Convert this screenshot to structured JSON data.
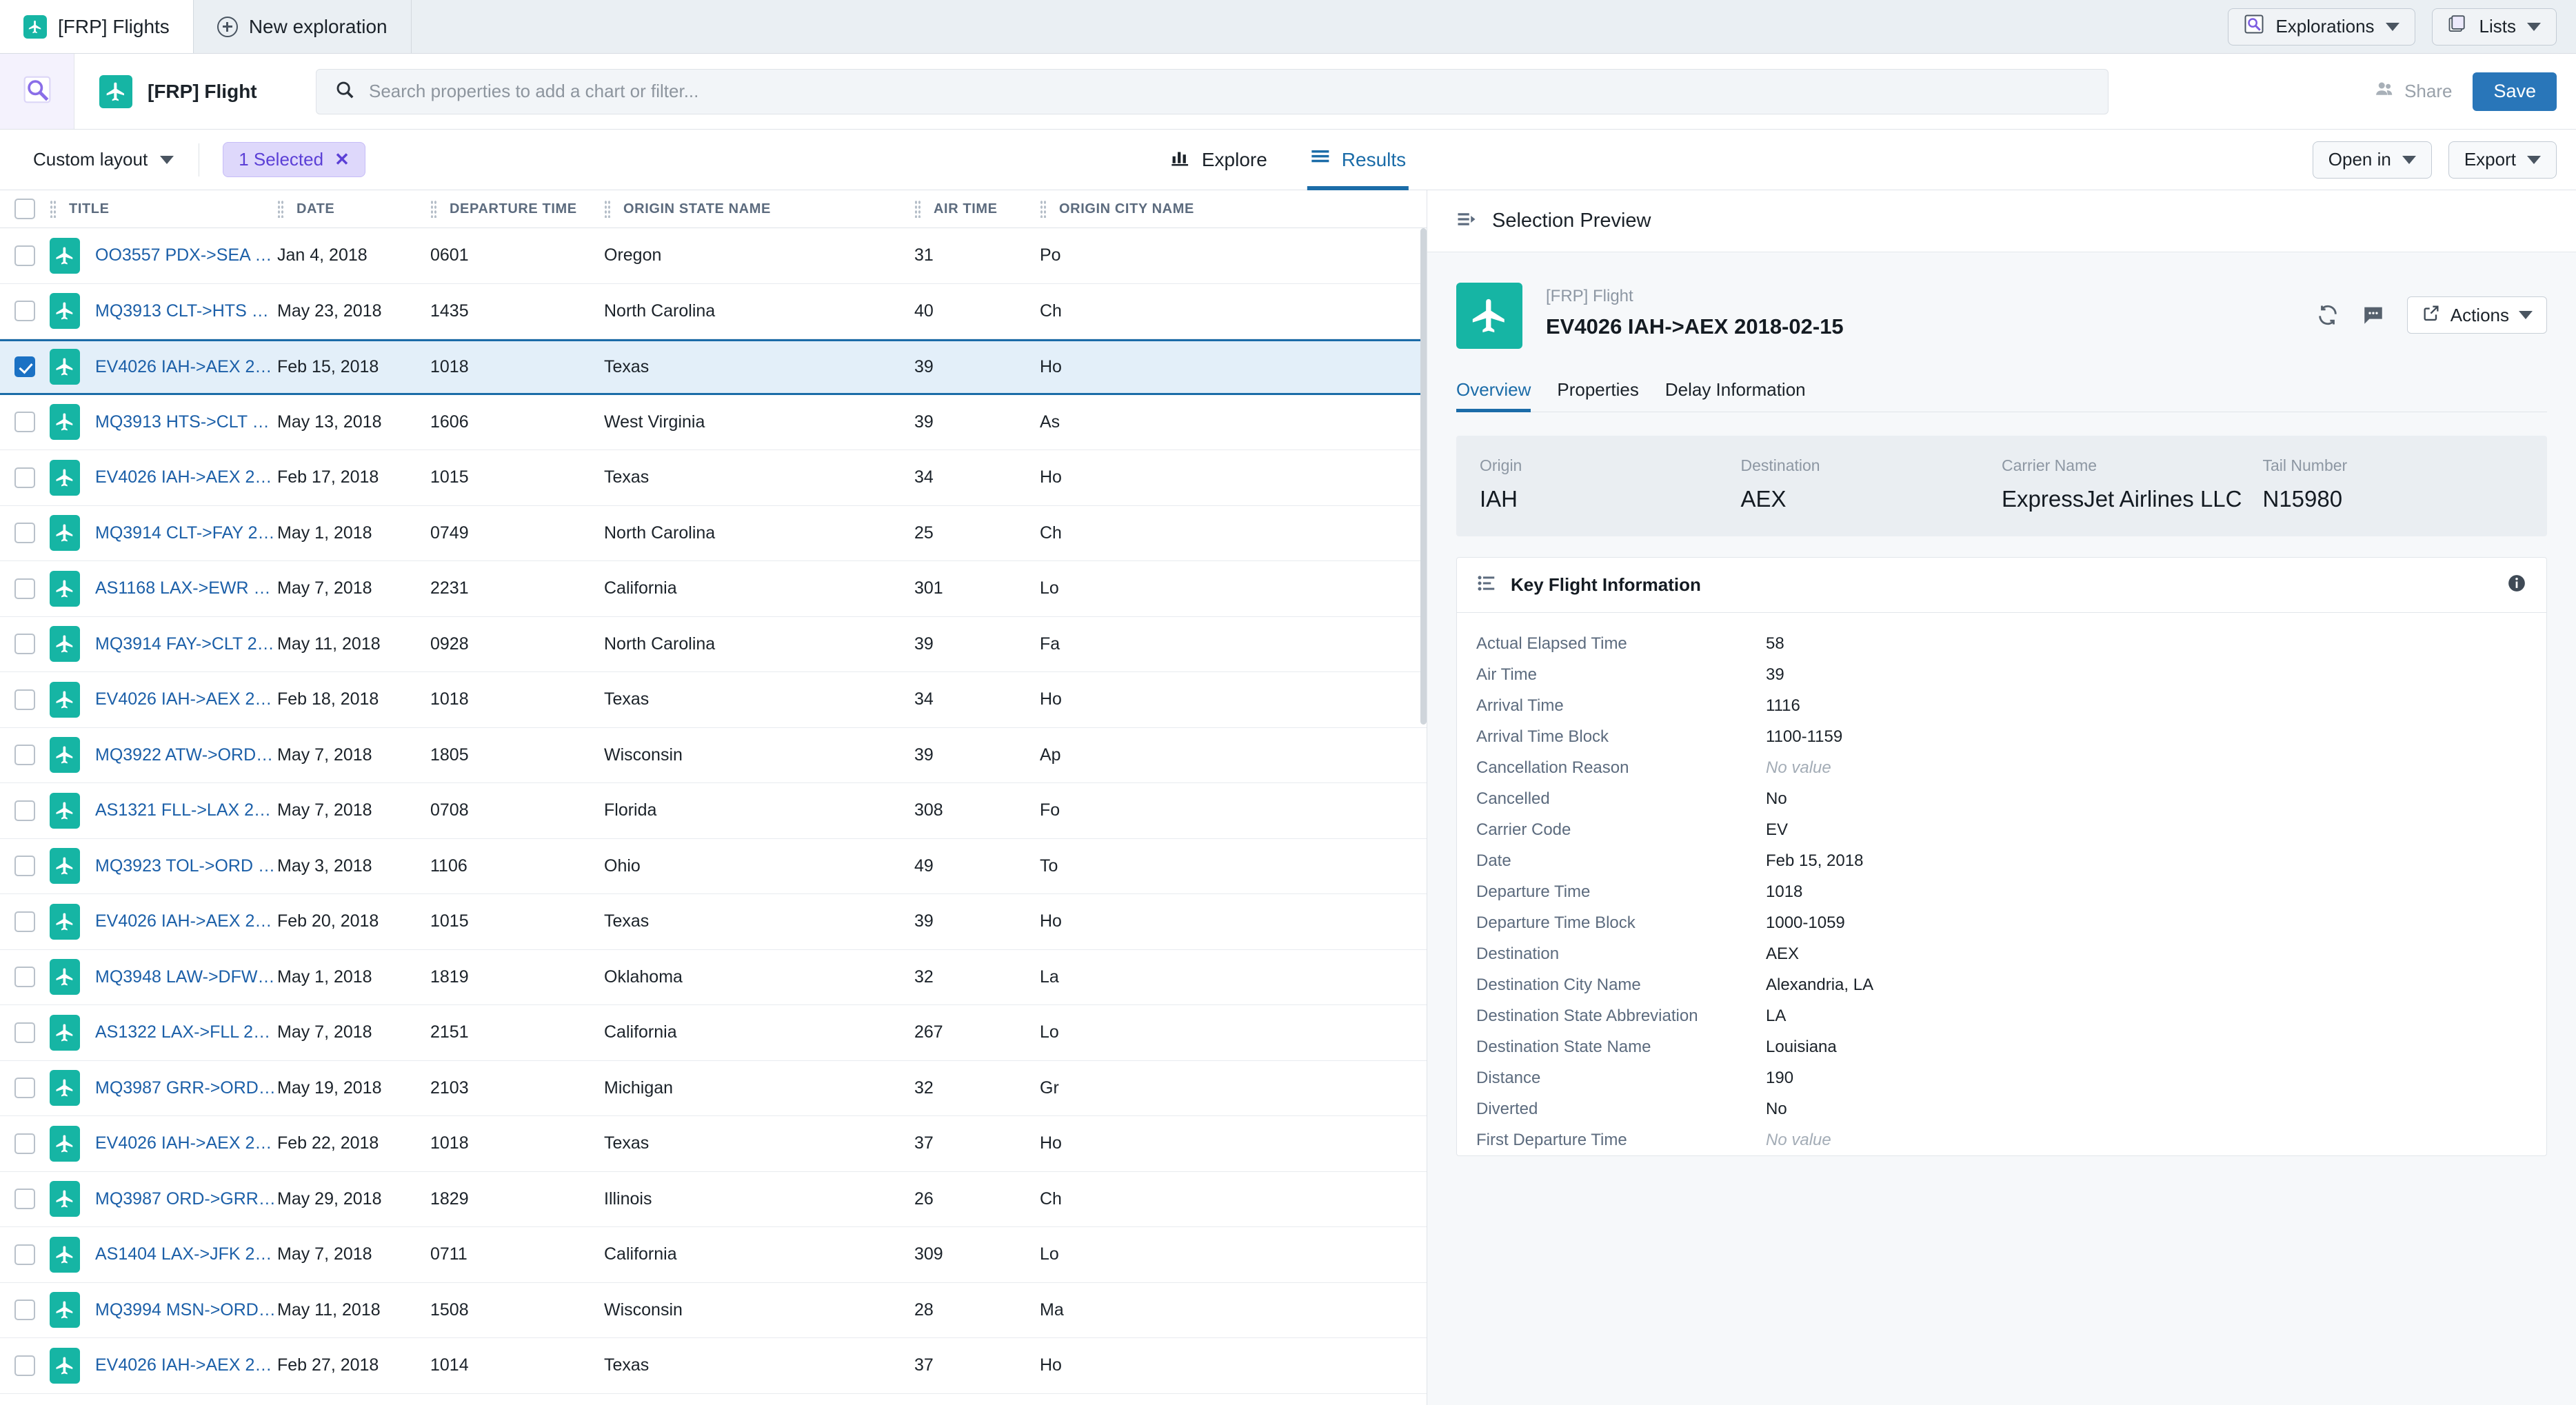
{
  "tabbar": {
    "tabs": [
      {
        "label": "[FRP] Flights",
        "icon": "plane-icon",
        "active": true
      },
      {
        "label": "New exploration",
        "icon": "plus-circle-icon",
        "active": false
      }
    ],
    "explorations_label": "Explorations",
    "lists_label": "Lists"
  },
  "searchrow": {
    "object_title": "[FRP] Flight",
    "search_placeholder": "Search properties to add a chart or filter...",
    "share_label": "Share",
    "save_label": "Save"
  },
  "toolbar": {
    "layout_label": "Custom layout",
    "selection_chip": "1 Selected",
    "selection_chip_close": "✕",
    "tabs": [
      {
        "label": "Explore",
        "icon": "bar-chart-icon",
        "active": false
      },
      {
        "label": "Results",
        "icon": "list-icon",
        "active": true
      }
    ],
    "open_in_label": "Open in",
    "export_label": "Export"
  },
  "table": {
    "columns": [
      "TITLE",
      "DATE",
      "DEPARTURE TIME",
      "ORIGIN STATE NAME",
      "AIR TIME",
      "ORIGIN CITY NAME"
    ],
    "rows": [
      {
        "selected": false,
        "title": "OO3557 PDX->SEA 2018...",
        "date": "Jan 4, 2018",
        "departure_time": "0601",
        "origin_state": "Oregon",
        "air_time": "31",
        "origin_city": "Po"
      },
      {
        "selected": false,
        "title": "MQ3913 CLT->HTS 2018...",
        "date": "May 23, 2018",
        "departure_time": "1435",
        "origin_state": "North Carolina",
        "air_time": "40",
        "origin_city": "Ch"
      },
      {
        "selected": true,
        "title": "EV4026 IAH->AEX 2018-...",
        "date": "Feb 15, 2018",
        "departure_time": "1018",
        "origin_state": "Texas",
        "air_time": "39",
        "origin_city": "Ho"
      },
      {
        "selected": false,
        "title": "MQ3913 HTS->CLT 2018...",
        "date": "May 13, 2018",
        "departure_time": "1606",
        "origin_state": "West Virginia",
        "air_time": "39",
        "origin_city": "As"
      },
      {
        "selected": false,
        "title": "EV4026 IAH->AEX 2018-...",
        "date": "Feb 17, 2018",
        "departure_time": "1015",
        "origin_state": "Texas",
        "air_time": "34",
        "origin_city": "Ho"
      },
      {
        "selected": false,
        "title": "MQ3914 CLT->FAY 2018...",
        "date": "May 1, 2018",
        "departure_time": "0749",
        "origin_state": "North Carolina",
        "air_time": "25",
        "origin_city": "Ch"
      },
      {
        "selected": false,
        "title": "AS1168 LAX->EWR 201...",
        "date": "May 7, 2018",
        "departure_time": "2231",
        "origin_state": "California",
        "air_time": "301",
        "origin_city": "Lo"
      },
      {
        "selected": false,
        "title": "MQ3914 FAY->CLT 2018...",
        "date": "May 11, 2018",
        "departure_time": "0928",
        "origin_state": "North Carolina",
        "air_time": "39",
        "origin_city": "Fa"
      },
      {
        "selected": false,
        "title": "EV4026 IAH->AEX 2018-...",
        "date": "Feb 18, 2018",
        "departure_time": "1018",
        "origin_state": "Texas",
        "air_time": "34",
        "origin_city": "Ho"
      },
      {
        "selected": false,
        "title": "MQ3922 ATW->ORD 201...",
        "date": "May 7, 2018",
        "departure_time": "1805",
        "origin_state": "Wisconsin",
        "air_time": "39",
        "origin_city": "Ap"
      },
      {
        "selected": false,
        "title": "AS1321 FLL->LAX 2018...",
        "date": "May 7, 2018",
        "departure_time": "0708",
        "origin_state": "Florida",
        "air_time": "308",
        "origin_city": "Fo"
      },
      {
        "selected": false,
        "title": "MQ3923 TOL->ORD 201...",
        "date": "May 3, 2018",
        "departure_time": "1106",
        "origin_state": "Ohio",
        "air_time": "49",
        "origin_city": "To"
      },
      {
        "selected": false,
        "title": "EV4026 IAH->AEX 2018-...",
        "date": "Feb 20, 2018",
        "departure_time": "1015",
        "origin_state": "Texas",
        "air_time": "39",
        "origin_city": "Ho"
      },
      {
        "selected": false,
        "title": "MQ3948 LAW->DFW 201...",
        "date": "May 1, 2018",
        "departure_time": "1819",
        "origin_state": "Oklahoma",
        "air_time": "32",
        "origin_city": "La"
      },
      {
        "selected": false,
        "title": "AS1322 LAX->FLL 2018...",
        "date": "May 7, 2018",
        "departure_time": "2151",
        "origin_state": "California",
        "air_time": "267",
        "origin_city": "Lo"
      },
      {
        "selected": false,
        "title": "MQ3987 GRR->ORD 201...",
        "date": "May 19, 2018",
        "departure_time": "2103",
        "origin_state": "Michigan",
        "air_time": "32",
        "origin_city": "Gr"
      },
      {
        "selected": false,
        "title": "EV4026 IAH->AEX 2018-...",
        "date": "Feb 22, 2018",
        "departure_time": "1018",
        "origin_state": "Texas",
        "air_time": "37",
        "origin_city": "Ho"
      },
      {
        "selected": false,
        "title": "MQ3987 ORD->GRR 201...",
        "date": "May 29, 2018",
        "departure_time": "1829",
        "origin_state": "Illinois",
        "air_time": "26",
        "origin_city": "Ch"
      },
      {
        "selected": false,
        "title": "AS1404 LAX->JFK 2018...",
        "date": "May 7, 2018",
        "departure_time": "0711",
        "origin_state": "California",
        "air_time": "309",
        "origin_city": "Lo"
      },
      {
        "selected": false,
        "title": "MQ3994 MSN->ORD 201...",
        "date": "May 11, 2018",
        "departure_time": "1508",
        "origin_state": "Wisconsin",
        "air_time": "28",
        "origin_city": "Ma"
      },
      {
        "selected": false,
        "title": "EV4026 IAH->AEX 2018-...",
        "date": "Feb 27, 2018",
        "departure_time": "1014",
        "origin_state": "Texas",
        "air_time": "37",
        "origin_city": "Ho"
      }
    ]
  },
  "preview": {
    "header_title": "Selection Preview",
    "entity_type": "[FRP] Flight",
    "entity_name": "EV4026 IAH->AEX 2018-02-15",
    "actions_label": "Actions",
    "tabs": [
      {
        "label": "Overview",
        "active": true
      },
      {
        "label": "Properties",
        "active": false
      },
      {
        "label": "Delay Information",
        "active": false
      }
    ],
    "summary": [
      {
        "label": "Origin",
        "value": "IAH"
      },
      {
        "label": "Destination",
        "value": "AEX"
      },
      {
        "label": "Carrier Name",
        "value": "ExpressJet Airlines LLC"
      },
      {
        "label": "Tail Number",
        "value": "N15980"
      }
    ],
    "key_flight_information": {
      "title": "Key Flight Information",
      "rows": [
        {
          "key": "Actual Elapsed Time",
          "value": "58",
          "novalue": false
        },
        {
          "key": "Air Time",
          "value": "39",
          "novalue": false
        },
        {
          "key": "Arrival Time",
          "value": "1116",
          "novalue": false
        },
        {
          "key": "Arrival Time Block",
          "value": "1100-1159",
          "novalue": false
        },
        {
          "key": "Cancellation Reason",
          "value": "No value",
          "novalue": true
        },
        {
          "key": "Cancelled",
          "value": "No",
          "novalue": false
        },
        {
          "key": "Carrier Code",
          "value": "EV",
          "novalue": false
        },
        {
          "key": "Date",
          "value": "Feb 15, 2018",
          "novalue": false
        },
        {
          "key": "Departure Time",
          "value": "1018",
          "novalue": false
        },
        {
          "key": "Departure Time Block",
          "value": "1000-1059",
          "novalue": false
        },
        {
          "key": "Destination",
          "value": "AEX",
          "novalue": false
        },
        {
          "key": "Destination City Name",
          "value": "Alexandria, LA",
          "novalue": false
        },
        {
          "key": "Destination State Abbreviation",
          "value": "LA",
          "novalue": false
        },
        {
          "key": "Destination State Name",
          "value": "Louisiana",
          "novalue": false
        },
        {
          "key": "Distance",
          "value": "190",
          "novalue": false
        },
        {
          "key": "Diverted",
          "value": "No",
          "novalue": false
        },
        {
          "key": "First Departure Time",
          "value": "No value",
          "novalue": true
        }
      ]
    }
  },
  "colors": {
    "brand_teal": "#16b5a4",
    "accent_blue": "#1b6ca8",
    "save_blue": "#2976b9",
    "chip_purple": "#5b3fd6",
    "link_blue": "#1b5fa8"
  }
}
